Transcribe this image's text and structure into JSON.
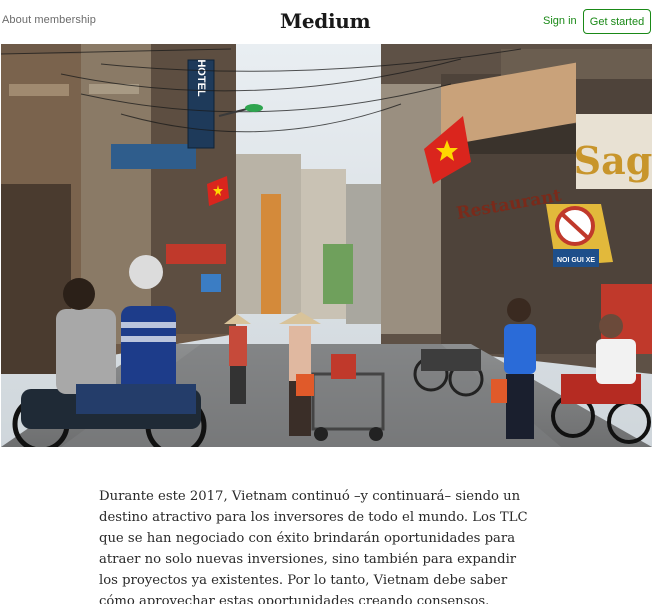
{
  "header": {
    "about_label": "About membership",
    "logo_text": "Medium",
    "signin_label": "Sign in",
    "get_started_label": "Get started"
  },
  "hero": {
    "signs": {
      "hotel": "HOTEL",
      "restaurant": "Restaurant",
      "sag": "Sag",
      "noi_guixe": "NOI GUI XE"
    }
  },
  "article": {
    "paragraph": "Durante este 2017, Vietnam continuó –y continuará– siendo un destino atractivo para los inversores de todo el mundo. Los TLC que se han negociado con éxito brindarán oportunidades para atraer no solo nuevas inversiones, sino también para expandir los proyectos ya existentes. Por lo tanto, Vietnam debe saber cómo aprovechar estas oportunidades creando consensos."
  },
  "colors": {
    "brand_green": "#1a8917",
    "flag_red": "#da251d",
    "flag_star": "#ffd700"
  }
}
